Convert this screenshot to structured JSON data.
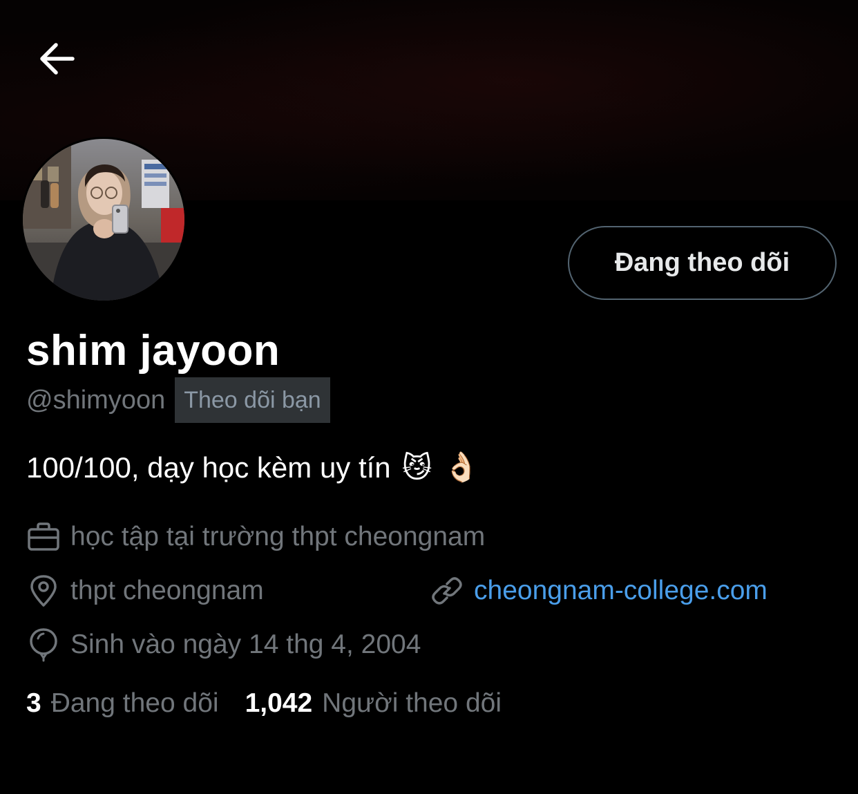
{
  "header": {
    "back_icon": "arrow-left-icon"
  },
  "profile": {
    "display_name": "shim jayoon",
    "handle": "@shimyoon",
    "follows_you_badge": "Theo dõi bạn",
    "follow_button_label": "Đang theo dõi",
    "bio": "100/100, dạy học kèm uy tín",
    "bio_emojis": [
      "😼",
      "👌🏻"
    ],
    "work": "học tập tại trường thpt cheongnam",
    "location": "thpt cheongnam",
    "website": "cheongnam-college.com",
    "birthday": "Sinh vào ngày 14 thg 4, 2004"
  },
  "stats": {
    "following_count": "3",
    "following_label": "Đang theo dõi",
    "followers_count": "1,042",
    "followers_label": "Người theo dõi"
  },
  "colors": {
    "background": "#000000",
    "secondary_text": "#71767b",
    "link": "#4a9eea",
    "button_border": "#536471",
    "badge_bg": "#2f3336"
  }
}
